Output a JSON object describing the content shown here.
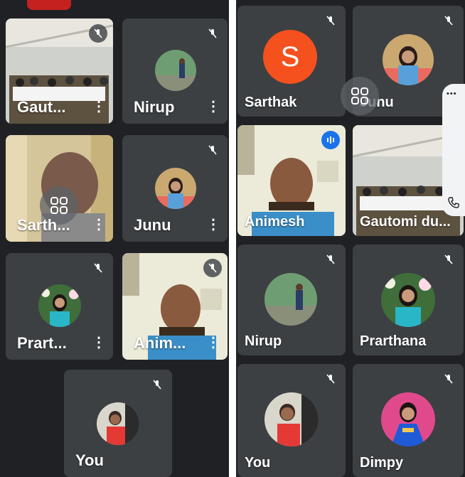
{
  "left": {
    "tiles": [
      {
        "name": "Gaut...",
        "muted": true
      },
      {
        "name": "Nirup",
        "muted": true
      },
      {
        "name": "Sarth...",
        "muted": false
      },
      {
        "name": "Junu",
        "muted": true
      },
      {
        "name": "Prart...",
        "muted": true
      },
      {
        "name": "Anim...",
        "muted": true
      },
      {
        "name": "You",
        "muted": true
      }
    ]
  },
  "right": {
    "tiles": [
      {
        "name": "Sarthak",
        "avatar_letter": "S",
        "muted": true
      },
      {
        "name": "Junu",
        "muted": true
      },
      {
        "name": "Animesh",
        "speaking": true
      },
      {
        "name": "Gautomi du...",
        "muted": false
      },
      {
        "name": "Nirup",
        "muted": true
      },
      {
        "name": "Prarthana",
        "muted": true
      },
      {
        "name": "You",
        "muted": true
      },
      {
        "name": "Dimpy",
        "muted": true
      }
    ],
    "more_label": "⋮",
    "menu_dots": "•••"
  },
  "colors": {
    "background": "#202124",
    "tile": "#3c4043",
    "avatar_orange": "#f4511e",
    "speaking_blue": "#1a73e8"
  },
  "icons": {
    "mute": "mic-off-icon",
    "more": "more-vert-icon",
    "grid": "grid-view-icon",
    "phone": "phone-icon"
  }
}
